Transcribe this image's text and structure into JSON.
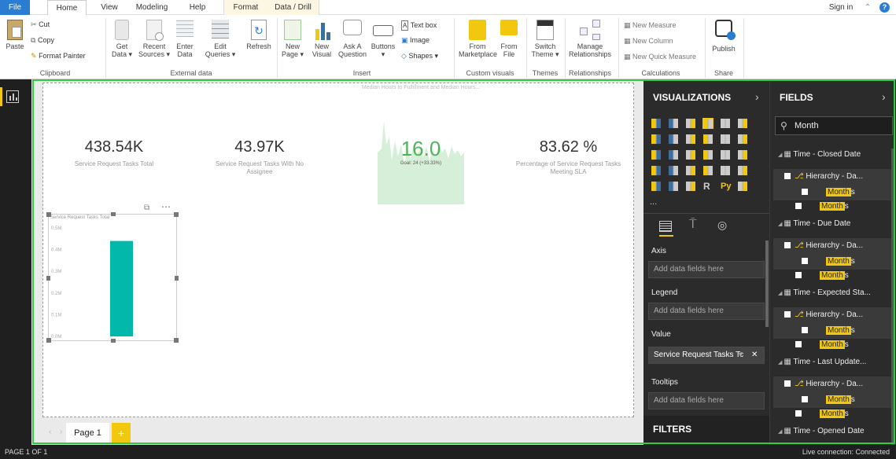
{
  "tabs": {
    "file": "File",
    "home": "Home",
    "view": "View",
    "modeling": "Modeling",
    "help": "Help",
    "format": "Format",
    "data_drill": "Data / Drill",
    "sign_in": "Sign in"
  },
  "ribbon": {
    "paste": "Paste",
    "cut": "Cut",
    "copy": "Copy",
    "format_painter": "Format Painter",
    "get_data": [
      "Get",
      "Data ▾"
    ],
    "recent_sources": [
      "Recent",
      "Sources ▾"
    ],
    "enter_data": [
      "Enter",
      "Data"
    ],
    "edit_queries": [
      "Edit",
      "Queries ▾"
    ],
    "refresh": "Refresh",
    "new_page": [
      "New",
      "Page ▾"
    ],
    "new_visual": [
      "New",
      "Visual"
    ],
    "ask_question": [
      "Ask A",
      "Question"
    ],
    "buttons": [
      "Buttons",
      "▾"
    ],
    "text_box": "Text box",
    "image": "Image",
    "shapes": "Shapes ▾",
    "from_marketplace": [
      "From",
      "Marketplace"
    ],
    "from_file": [
      "From",
      "File"
    ],
    "switch_theme": [
      "Switch",
      "Theme ▾"
    ],
    "manage_relationships": [
      "Manage",
      "Relationships"
    ],
    "new_measure": "New Measure",
    "new_column": "New Column",
    "new_quick_measure": "New Quick Measure",
    "publish": "Publish",
    "groups": {
      "clipboard": "Clipboard",
      "external_data": "External data",
      "insert": "Insert",
      "custom_visuals": "Custom visuals",
      "themes": "Themes",
      "relationships": "Relationships",
      "calculations": "Calculations",
      "share": "Share"
    }
  },
  "kpis": [
    {
      "value": "438.54K",
      "label": "Service Request Tasks Total"
    },
    {
      "value": "43.97K",
      "label": "Service Request Tasks With No Assignee"
    },
    {
      "value": "83.62 %",
      "label": "Percentage of Service Request Tasks Meeting SLA"
    }
  ],
  "gauge": {
    "title": "Median Hours to Fulfillment and Median Hours...",
    "value": "16.0",
    "goal": "Goal: 24 (+33.33%)"
  },
  "chart_data": {
    "type": "bar",
    "title": "Service Request Tasks Total",
    "categories": [
      ""
    ],
    "values": [
      0.44
    ],
    "ylim": [
      0,
      0.5
    ],
    "yticks": [
      "0.5M",
      "0.4M",
      "0.3M",
      "0.2M",
      "0.1M",
      "0.0M"
    ],
    "color": "#01b8aa"
  },
  "visualizations": {
    "title": "VISUALIZATIONS",
    "wells": [
      {
        "label": "Axis",
        "value": "Add data fields here"
      },
      {
        "label": "Legend",
        "value": "Add data fields here"
      },
      {
        "label": "Value",
        "value": "Service Request Tasks Tc"
      },
      {
        "label": "Tooltips",
        "value": "Add data fields here"
      }
    ],
    "filters": "FILTERS",
    "r_label": "R",
    "py_label": "Py",
    "more": "..."
  },
  "fields": {
    "title": "FIELDS",
    "search_value": "Month",
    "tables": [
      {
        "name": "Time - Closed Date",
        "hierarchy": "Hierarchy - Da...",
        "rows": [
          "Month",
          "Month"
        ]
      },
      {
        "name": "Time - Due Date",
        "hierarchy": "Hierarchy - Da...",
        "rows": [
          "Month",
          "Month"
        ]
      },
      {
        "name": "Time - Expected Sta...",
        "hierarchy": "Hierarchy - Da...",
        "rows": [
          "Month",
          "Month"
        ]
      },
      {
        "name": "Time - Last Update...",
        "hierarchy": "Hierarchy - Da...",
        "rows": [
          "Month",
          "Month"
        ]
      },
      {
        "name": "Time - Opened Date"
      }
    ],
    "month_suffix": "s"
  },
  "page_tab": "Page 1",
  "status": {
    "page": "PAGE 1 OF 1",
    "connection": "Live connection: Connected"
  },
  "colors": {
    "accent": "#2b7cd3",
    "highlight": "#f2c80f",
    "frame": "#2ecc40",
    "teal": "#01b8aa"
  }
}
